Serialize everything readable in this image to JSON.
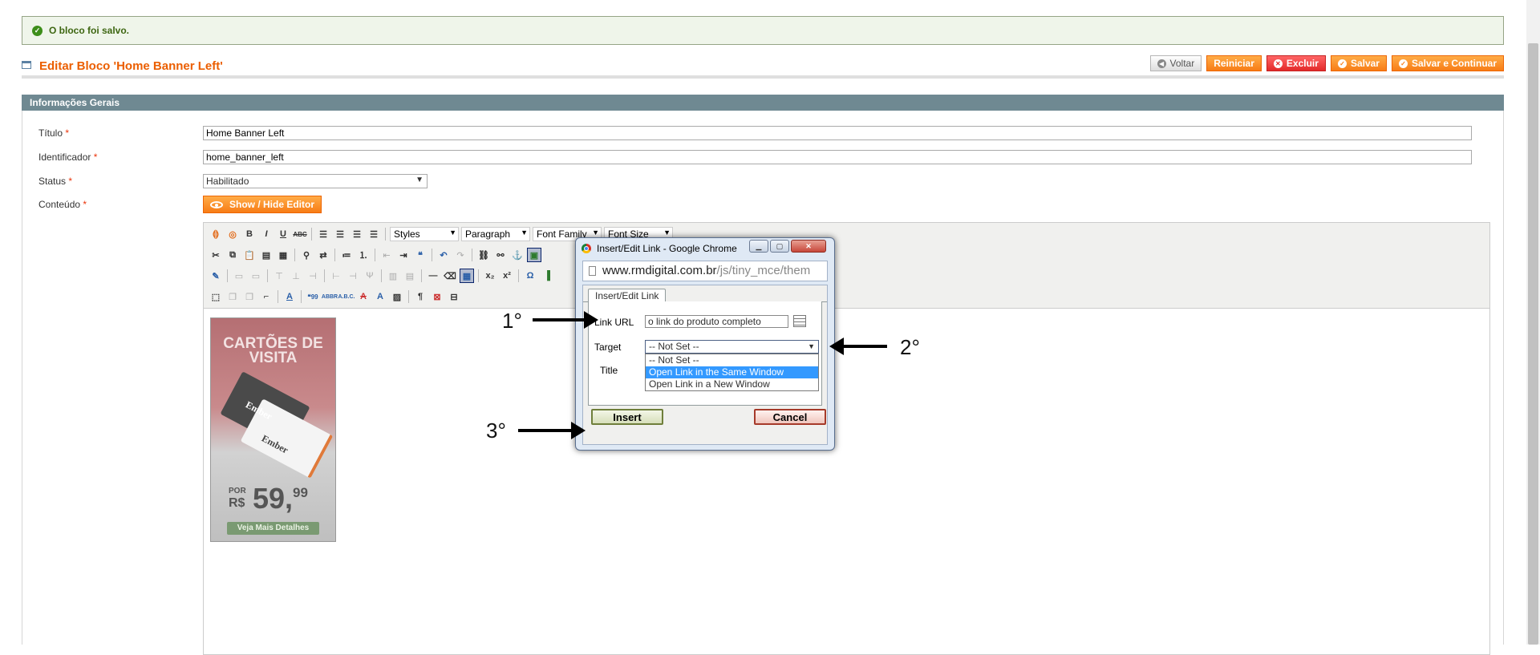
{
  "message": {
    "text": "O bloco foi salvo."
  },
  "header": {
    "title": "Editar Bloco 'Home Banner Left'",
    "buttons": {
      "back": "Voltar",
      "reset": "Reiniciar",
      "delete": "Excluir",
      "save": "Salvar",
      "save_continue": "Salvar e Continuar"
    }
  },
  "section": {
    "title": "Informações Gerais"
  },
  "form": {
    "title_label": "Título",
    "title_value": "Home Banner Left",
    "identifier_label": "Identificador",
    "identifier_value": "home_banner_left",
    "status_label": "Status",
    "status_value": "Habilitado",
    "content_label": "Conteúdo",
    "required_mark": "*",
    "toggle_editor": "Show / Hide Editor"
  },
  "editor": {
    "styles": "Styles",
    "paragraph": "Paragraph",
    "font_family": "Font Family",
    "font_size": "Font Size"
  },
  "banner": {
    "line1": "CARTÕES DE",
    "line2": "VISITA",
    "brand": "Ember",
    "por": "POR",
    "currency": "R$",
    "price": "59,",
    "cents": "99",
    "button": "Veja Mais Detalhes"
  },
  "popup": {
    "window_title": "Insert/Edit Link - Google Chrome",
    "url_host": "www.rmdigital.com.br",
    "url_path": "/js/tiny_mce/them",
    "tab": "Insert/Edit Link",
    "link_url_label": "Link URL",
    "link_url_value": "o link do produto completo",
    "target_label": "Target",
    "target_value": "-- Not Set --",
    "target_options": [
      "-- Not Set --",
      "Open Link in the Same Window",
      "Open Link in a New Window"
    ],
    "title_label": "Title",
    "insert": "Insert",
    "cancel": "Cancel"
  },
  "annotations": {
    "step1": "1°",
    "step2": "2°",
    "step3": "3°"
  }
}
